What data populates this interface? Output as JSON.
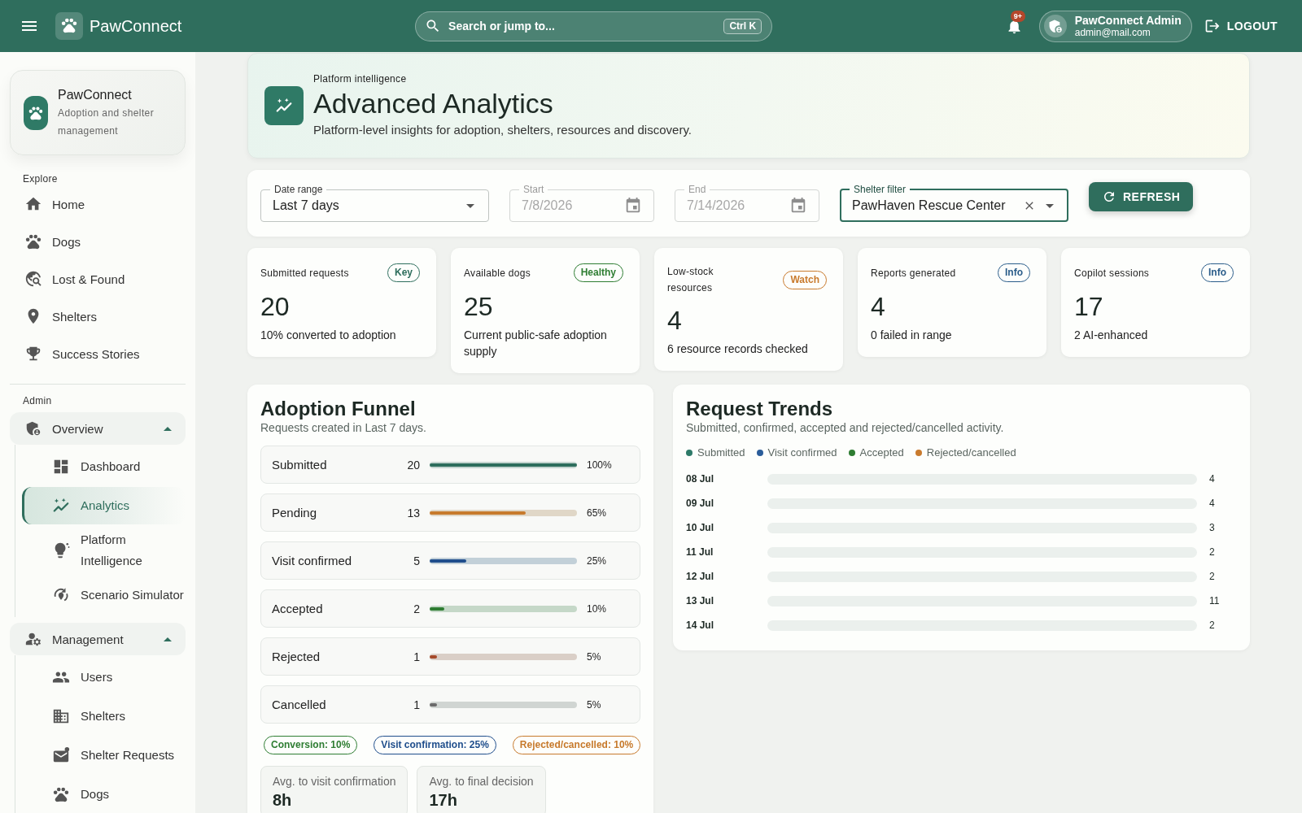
{
  "top_bar": {
    "brand": "PawConnect",
    "search": {
      "placeholder": "Search or jump to...",
      "shortcut": "Ctrl K"
    },
    "notifications": {
      "badge": "9+"
    },
    "user": {
      "name": "PawConnect Admin",
      "email": "admin@mail.com"
    },
    "logout": "LOGOUT"
  },
  "sidebar": {
    "brand": {
      "name": "PawConnect",
      "tagline": "Adoption and shelter management"
    },
    "explore": {
      "label": "Explore",
      "items": [
        {
          "label": "Home",
          "selected": false
        },
        {
          "label": "Dogs",
          "selected": false
        },
        {
          "label": "Lost & Found",
          "selected": false
        },
        {
          "label": "Shelters",
          "selected": false
        },
        {
          "label": "Success Stories",
          "selected": false
        }
      ]
    },
    "admin": {
      "label": "Admin",
      "groups": [
        {
          "label": "Overview",
          "expanded": true,
          "children": [
            {
              "label": "Dashboard",
              "selected": false
            },
            {
              "label": "Analytics",
              "selected": true
            },
            {
              "label": "Platform Intelligence",
              "selected": false
            },
            {
              "label": "Scenario Simulator",
              "selected": false
            }
          ]
        },
        {
          "label": "Management",
          "expanded": true,
          "children": [
            {
              "label": "Users",
              "selected": false
            },
            {
              "label": "Shelters",
              "selected": false
            },
            {
              "label": "Shelter Requests",
              "selected": false
            },
            {
              "label": "Dogs",
              "selected": false
            }
          ]
        }
      ]
    }
  },
  "header": {
    "eyebrow": "Platform intelligence",
    "title": "Advanced Analytics",
    "subtitle": "Platform-level insights for adoption, shelters, resources and discovery."
  },
  "filters": {
    "fields": [
      {
        "kind": "select",
        "label": "Date range",
        "value": "Last 7 days",
        "disabled": false,
        "focused": false,
        "clearable": false
      },
      {
        "kind": "date",
        "label": "Start",
        "value": "7/8/2026",
        "disabled": true,
        "focused": false,
        "clearable": false
      },
      {
        "kind": "date",
        "label": "End",
        "value": "7/14/2026",
        "disabled": true,
        "focused": false,
        "clearable": false
      },
      {
        "kind": "select",
        "label": "Shelter filter",
        "value": "PawHaven Rescue Center",
        "disabled": false,
        "focused": true,
        "clearable": true
      }
    ],
    "refresh": "REFRESH"
  },
  "stats": [
    {
      "label": "Submitted requests",
      "badge": {
        "label": "Key",
        "color": "#2e6e5d"
      },
      "value": "20",
      "description": "10% converted to adoption"
    },
    {
      "label": "Available dogs",
      "badge": {
        "label": "Healthy",
        "color": "#2e7d32"
      },
      "value": "25",
      "description": "Current public-safe adoption supply"
    },
    {
      "label": "Low-stock resources",
      "badge": {
        "label": "Watch",
        "color": "#c97b2e"
      },
      "value": "4",
      "description": "6 resource records checked"
    },
    {
      "label": "Reports generated",
      "badge": {
        "label": "Info",
        "color": "#2b5d8a"
      },
      "value": "4",
      "description": "0 failed in range"
    },
    {
      "label": "Copilot sessions",
      "badge": {
        "label": "Info",
        "color": "#2b5d8a"
      },
      "value": "17",
      "description": "2 AI-enhanced"
    }
  ],
  "funnel": {
    "title": "Adoption Funnel",
    "subtitle": "Requests created in Last 7 days.",
    "stages": [
      {
        "label": "Submitted",
        "count": "20",
        "level": 1,
        "percent": "100%",
        "color": "#2e6e5d"
      },
      {
        "label": "Pending",
        "count": "13",
        "level": 0.65,
        "percent": "65%",
        "color": "#c77a2c"
      },
      {
        "label": "Visit confirmed",
        "count": "5",
        "level": 0.25,
        "percent": "25%",
        "color": "#1f4e8c"
      },
      {
        "label": "Accepted",
        "count": "2",
        "level": 0.1,
        "percent": "10%",
        "color": "#2e7d32"
      },
      {
        "label": "Rejected",
        "count": "1",
        "level": 0.05,
        "percent": "5%",
        "color": "#a54a2a"
      },
      {
        "label": "Cancelled",
        "count": "1",
        "level": 0.05,
        "percent": "5%",
        "color": "#6b6b6b"
      }
    ],
    "rates": [
      {
        "label": "Conversion: 10%",
        "color": "#2e7d32"
      },
      {
        "label": "Visit confirmation: 25%",
        "color": "#1f4e8c"
      },
      {
        "label": "Rejected/cancelled: 10%",
        "color": "#c77a2c"
      }
    ],
    "averages": [
      {
        "label": "Avg. to visit confirmation",
        "value": "8h"
      },
      {
        "label": "Avg. to final decision",
        "value": "17h"
      }
    ]
  },
  "trends": {
    "title": "Request Trends",
    "subtitle": "Submitted, confirmed, accepted and rejected/cancelled activity.",
    "legend": [
      {
        "label": "Submitted",
        "color": "#2e7a68"
      },
      {
        "label": "Visit confirmed",
        "color": "#2b5d9a"
      },
      {
        "label": "Accepted",
        "color": "#2e7d32"
      },
      {
        "label": "Rejected/cancelled",
        "color": "#c97b2e"
      }
    ],
    "rows": [
      {
        "date": "08 Jul",
        "total": "4"
      },
      {
        "date": "09 Jul",
        "total": "4"
      },
      {
        "date": "10 Jul",
        "total": "3"
      },
      {
        "date": "11 Jul",
        "total": "2"
      },
      {
        "date": "12 Jul",
        "total": "2"
      },
      {
        "date": "13 Jul",
        "total": "11"
      },
      {
        "date": "14 Jul",
        "total": "2"
      }
    ]
  }
}
